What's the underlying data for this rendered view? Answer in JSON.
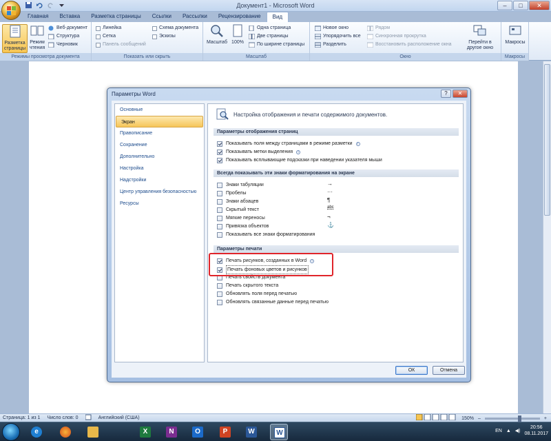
{
  "window": {
    "title": "Документ1 - Microsoft Word",
    "min": "–",
    "max": "□",
    "close": "✕"
  },
  "tabs": [
    "Главная",
    "Вставка",
    "Разметка страницы",
    "Ссылки",
    "Рассылки",
    "Рецензирование",
    "Вид"
  ],
  "active_tab": "Вид",
  "ribbon": {
    "group1": {
      "label": "Режимы просмотра документа",
      "btn1": "Разметка страницы",
      "btn2": "Режим чтения",
      "web": "Веб-документ",
      "structure": "Структура",
      "draft": "Черновик"
    },
    "group2": {
      "label": "Показать или скрыть",
      "ruler": "Линейка",
      "grid": "Сетка",
      "msgbar": "Панель сообщений",
      "docmap": "Схема документа",
      "thumbs": "Эскизы"
    },
    "group3": {
      "label": "Масштаб",
      "zoom": "Масштаб",
      "pct": "100%",
      "one": "Одна страница",
      "two": "Две страницы",
      "width": "По ширине страницы"
    },
    "group4": {
      "label": "Окно",
      "new": "Новое окно",
      "arrange": "Упорядочить все",
      "split": "Разделить",
      "side": "Рядом",
      "sync": "Синхронная прокрутка",
      "reset": "Восстановить расположение окна",
      "switch": "Перейти в другое окно"
    },
    "group5": {
      "label": "Макросы",
      "macros": "Макросы"
    }
  },
  "dialog": {
    "title": "Параметры Word",
    "help": "?",
    "close": "✕",
    "nav": [
      "Основные",
      "Экран",
      "Правописание",
      "Сохранение",
      "Дополнительно",
      "Настройка",
      "Надстройки",
      "Центр управления безопасностью",
      "Ресурсы"
    ],
    "nav_selected": "Экран",
    "header": "Настройка отображения и печати содержимого документов.",
    "sec1": {
      "title": "Параметры отображения страниц",
      "items": [
        {
          "label": "Показывать поля между страницами в режиме разметки",
          "checked": true,
          "info": true
        },
        {
          "label": "Показывать метки выделения",
          "checked": true,
          "info": true
        },
        {
          "label": "Показывать всплывающие подсказки при наведении указателя мыши",
          "checked": true,
          "info": false
        }
      ]
    },
    "sec2": {
      "title": "Всегда показывать эти знаки форматирования на экране",
      "items": [
        {
          "label": "Знаки табуляции",
          "checked": false,
          "symbol": "→"
        },
        {
          "label": "Пробелы",
          "checked": false,
          "symbol": "···"
        },
        {
          "label": "Знаки абзацев",
          "checked": false,
          "symbol": "¶"
        },
        {
          "label": "Скрытый текст",
          "checked": false,
          "symbol": "abc"
        },
        {
          "label": "Мягкие переносы",
          "checked": false,
          "symbol": "¬"
        },
        {
          "label": "Привязка объектов",
          "checked": false,
          "symbol": "⚓"
        },
        {
          "label": "Показывать все знаки форматирования",
          "checked": false,
          "symbol": ""
        }
      ]
    },
    "sec3": {
      "title": "Параметры печати",
      "items": [
        {
          "label": "Печать рисунков, созданных в Word",
          "checked": true,
          "info": true
        },
        {
          "label": "Печать фоновых цветов и рисунков",
          "checked": true,
          "info": false
        },
        {
          "label": "Печать свойств документа",
          "checked": false,
          "info": false
        },
        {
          "label": "Печать скрытого текста",
          "checked": false,
          "info": false
        },
        {
          "label": "Обновлять поля перед печатью",
          "checked": false,
          "info": false
        },
        {
          "label": "Обновлять связанные данные перед печатью",
          "checked": false,
          "info": false
        }
      ]
    },
    "ok": "ОК",
    "cancel": "Отмена"
  },
  "status": {
    "page": "Страница: 1 из 1",
    "words": "Число слов: 0",
    "lang": "Английский (США)",
    "zoom": "150%",
    "minus": "–",
    "plus": "+"
  },
  "taskbar": {
    "lang": "EN",
    "time": "20:56",
    "date": "08.11.2017",
    "apps": [
      "ie-icon",
      "firefox-icon",
      "folder-icon",
      "excel-icon",
      "onenote-icon",
      "outlook-icon",
      "powerpoint-icon",
      "word-icon",
      "word-doc-icon"
    ]
  }
}
